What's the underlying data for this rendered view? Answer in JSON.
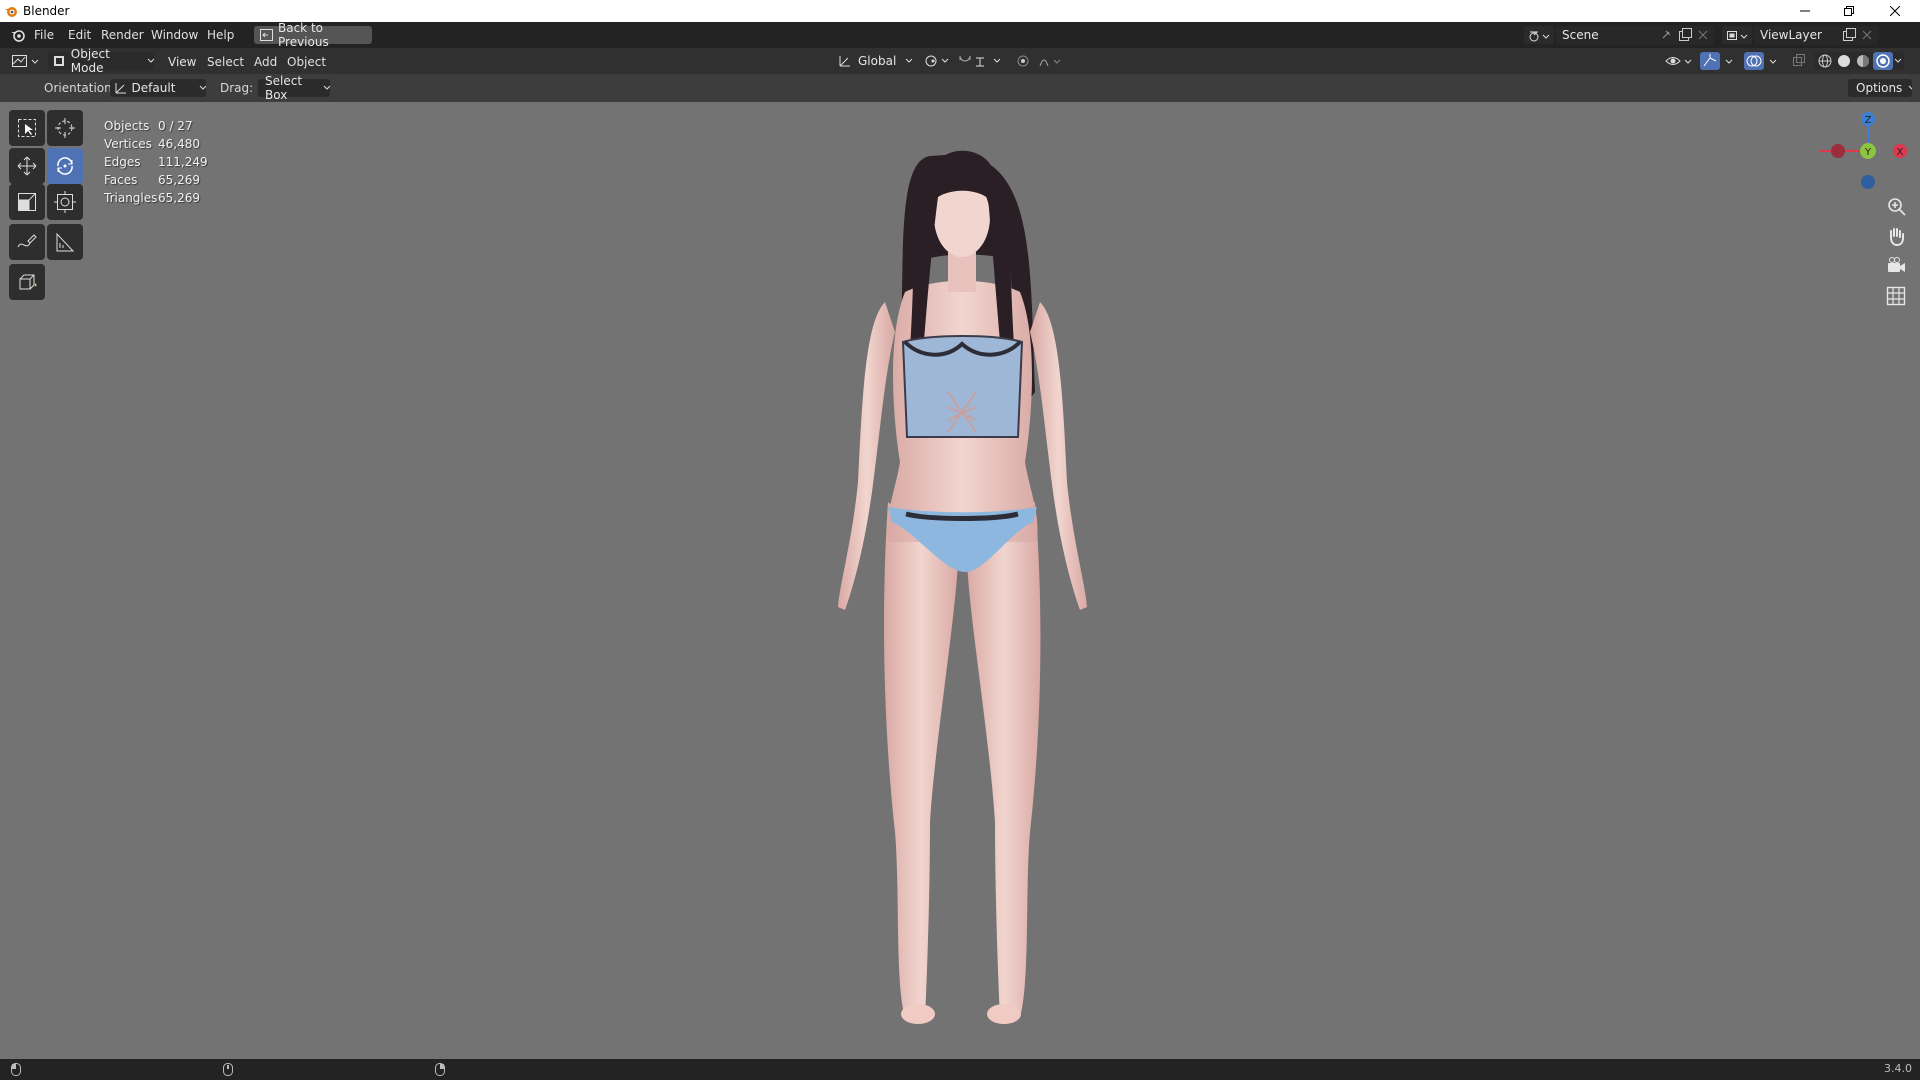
{
  "window": {
    "title": "Blender"
  },
  "menu": [
    "File",
    "Edit",
    "Render",
    "Window",
    "Help"
  ],
  "back_button": "Back to Previous",
  "scene": {
    "name": "Scene",
    "viewlayer": "ViewLayer"
  },
  "header": {
    "mode": "Object Mode",
    "menus": [
      "View",
      "Select",
      "Add",
      "Object"
    ],
    "transform_orientation": "Global"
  },
  "tool_settings": {
    "orientation_label": "Orientation:",
    "orientation_value": "Default",
    "drag_label": "Drag:",
    "drag_value": "Select Box",
    "options": "Options"
  },
  "stats": [
    {
      "label": "Objects",
      "value": "0 / 27"
    },
    {
      "label": "Vertices",
      "value": "46,480"
    },
    {
      "label": "Edges",
      "value": "111,249"
    },
    {
      "label": "Faces",
      "value": "65,269"
    },
    {
      "label": "Triangles",
      "value": "65,269"
    }
  ],
  "gizmo": {
    "z": "Z",
    "y": "Y",
    "x": "X"
  },
  "version": "3.4.0",
  "colors": {
    "active_tool": "#4f72b5",
    "axis_x": "#e0384f",
    "axis_y": "#8cc63f",
    "axis_z": "#3e7fd6"
  }
}
